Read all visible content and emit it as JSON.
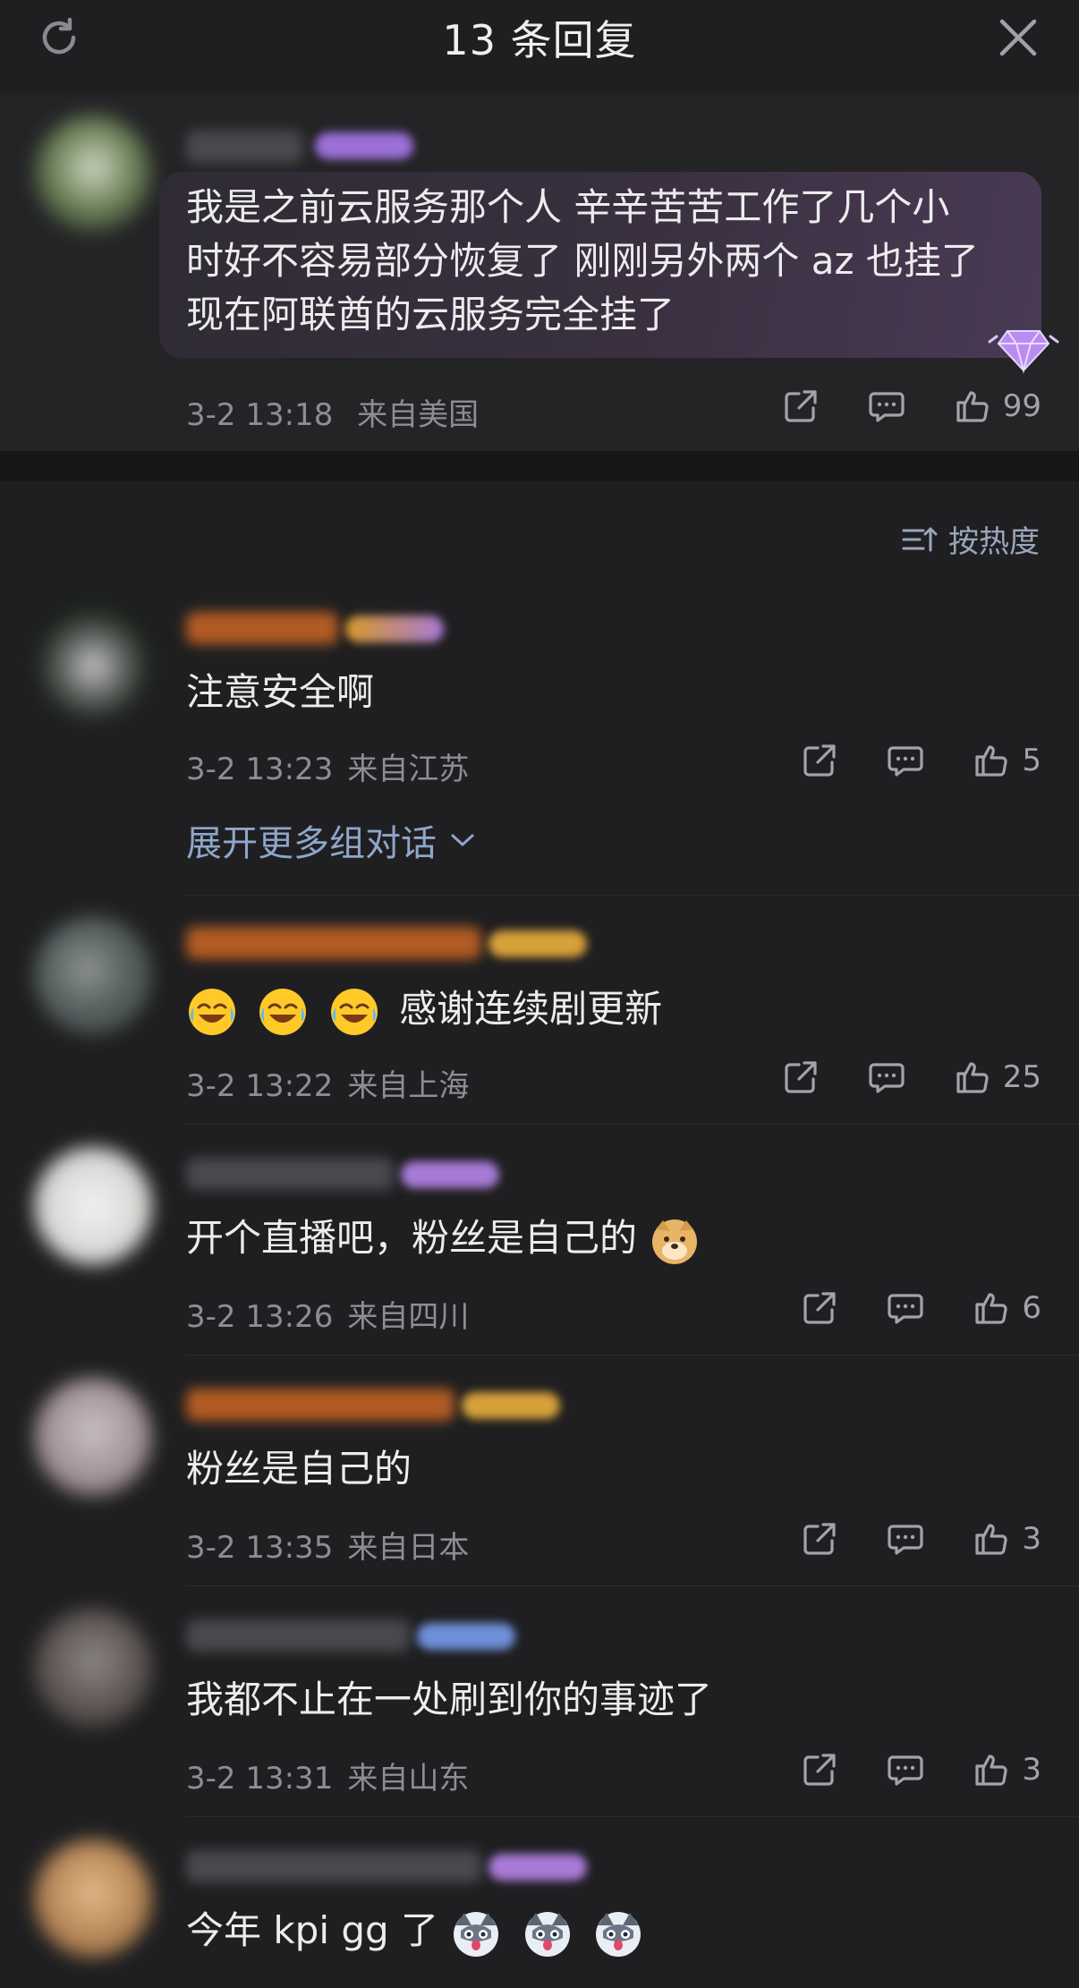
{
  "header": {
    "title": "13 条回复",
    "refresh_icon": "refresh-icon",
    "close_icon": "close-icon"
  },
  "colors": {
    "background": "#1f1f21",
    "link": "#8ea6c9",
    "muted": "#8d8d92",
    "bubble_accent": "#4a3a55"
  },
  "top_comment": {
    "lines": [
      "我是之前云服务那个人 辛辛苦苦工作了几个小",
      "时好不容易部分恢复了 刚刚另外两个 az 也挂了",
      "现在阿联酋的云服务完全挂了"
    ],
    "date": "3-2 13:18",
    "location": "来自美国",
    "likes": "99"
  },
  "sort": {
    "label": "按热度"
  },
  "replies": [
    {
      "text": "注意安全啊",
      "date": "3-2 13:23",
      "location": "来自江苏",
      "likes": "5"
    },
    {
      "text": "感谢连续剧更新",
      "emoji_prefix": [
        "laugh-cry-emoji",
        "laugh-cry-emoji",
        "laugh-cry-emoji"
      ],
      "date": "3-2 13:22",
      "location": "来自上海",
      "likes": "25"
    },
    {
      "text": "开个直播吧，粉丝是自己的",
      "emoji_suffix": [
        "doge-emoji"
      ],
      "date": "3-2 13:26",
      "location": "来自四川",
      "likes": "6"
    },
    {
      "text": "粉丝是自己的",
      "date": "3-2 13:35",
      "location": "来自日本",
      "likes": "3"
    },
    {
      "text": "我都不止在一处刷到你的事迹了",
      "date": "3-2 13:31",
      "location": "来自山东",
      "likes": "3"
    },
    {
      "text": "今年 kpi gg 了",
      "emoji_suffix": [
        "husky-emoji",
        "husky-emoji",
        "husky-emoji"
      ]
    }
  ],
  "expand_more": {
    "label": "展开更多组对话"
  }
}
